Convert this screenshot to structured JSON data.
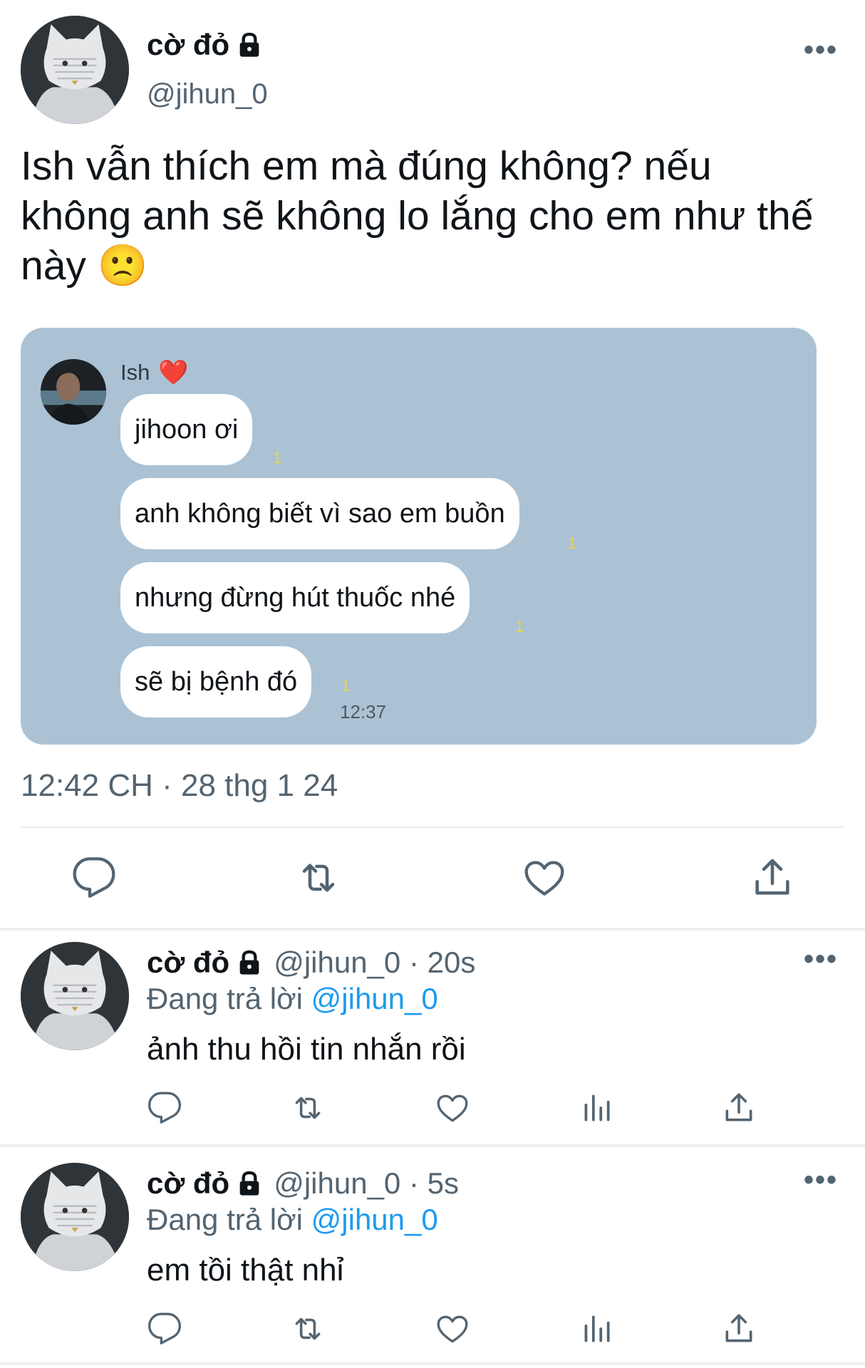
{
  "main_tweet": {
    "display_name": "cờ đỏ",
    "handle": "@jihun_0",
    "text": "Ish vẫn thích em mà đúng không? nếu không anh sẽ không lo lắng cho em như thế này 🙁",
    "timestamp": "12:42 CH · 28 thg 1 24",
    "chat_card": {
      "sender": "Ish",
      "sender_emoji": "❤️",
      "messages": [
        {
          "text": "jihoon ơi",
          "read": "1"
        },
        {
          "text": "anh không biết vì sao em buồn",
          "read": "1"
        },
        {
          "text": "nhưng đừng hút thuốc nhé",
          "read": "1"
        },
        {
          "text": "sẽ bị bệnh đó",
          "read": "1"
        }
      ],
      "time": "12:37"
    }
  },
  "replies": [
    {
      "display_name": "cờ đỏ",
      "meta": "@jihun_0 · 20s",
      "replying_prefix": "Đang trả lời",
      "replying_to": "@jihun_0",
      "text": "ảnh thu hồi tin nhắn rồi"
    },
    {
      "display_name": "cờ đỏ",
      "meta": "@jihun_0 · 5s",
      "replying_prefix": "Đang trả lời",
      "replying_to": "@jihun_0",
      "text": "em tồi thật nhỉ"
    }
  ],
  "icons": {
    "more": "more-horizontal-icon",
    "lock": "lock-icon",
    "reply": "reply-icon",
    "retweet": "retweet-icon",
    "like": "like-icon",
    "views": "views-icon",
    "share": "share-icon"
  },
  "colors": {
    "link": "#1d9bf0",
    "secondary": "#536471",
    "chat_background": "#abc2d4",
    "read_count": "#e8d84a"
  }
}
